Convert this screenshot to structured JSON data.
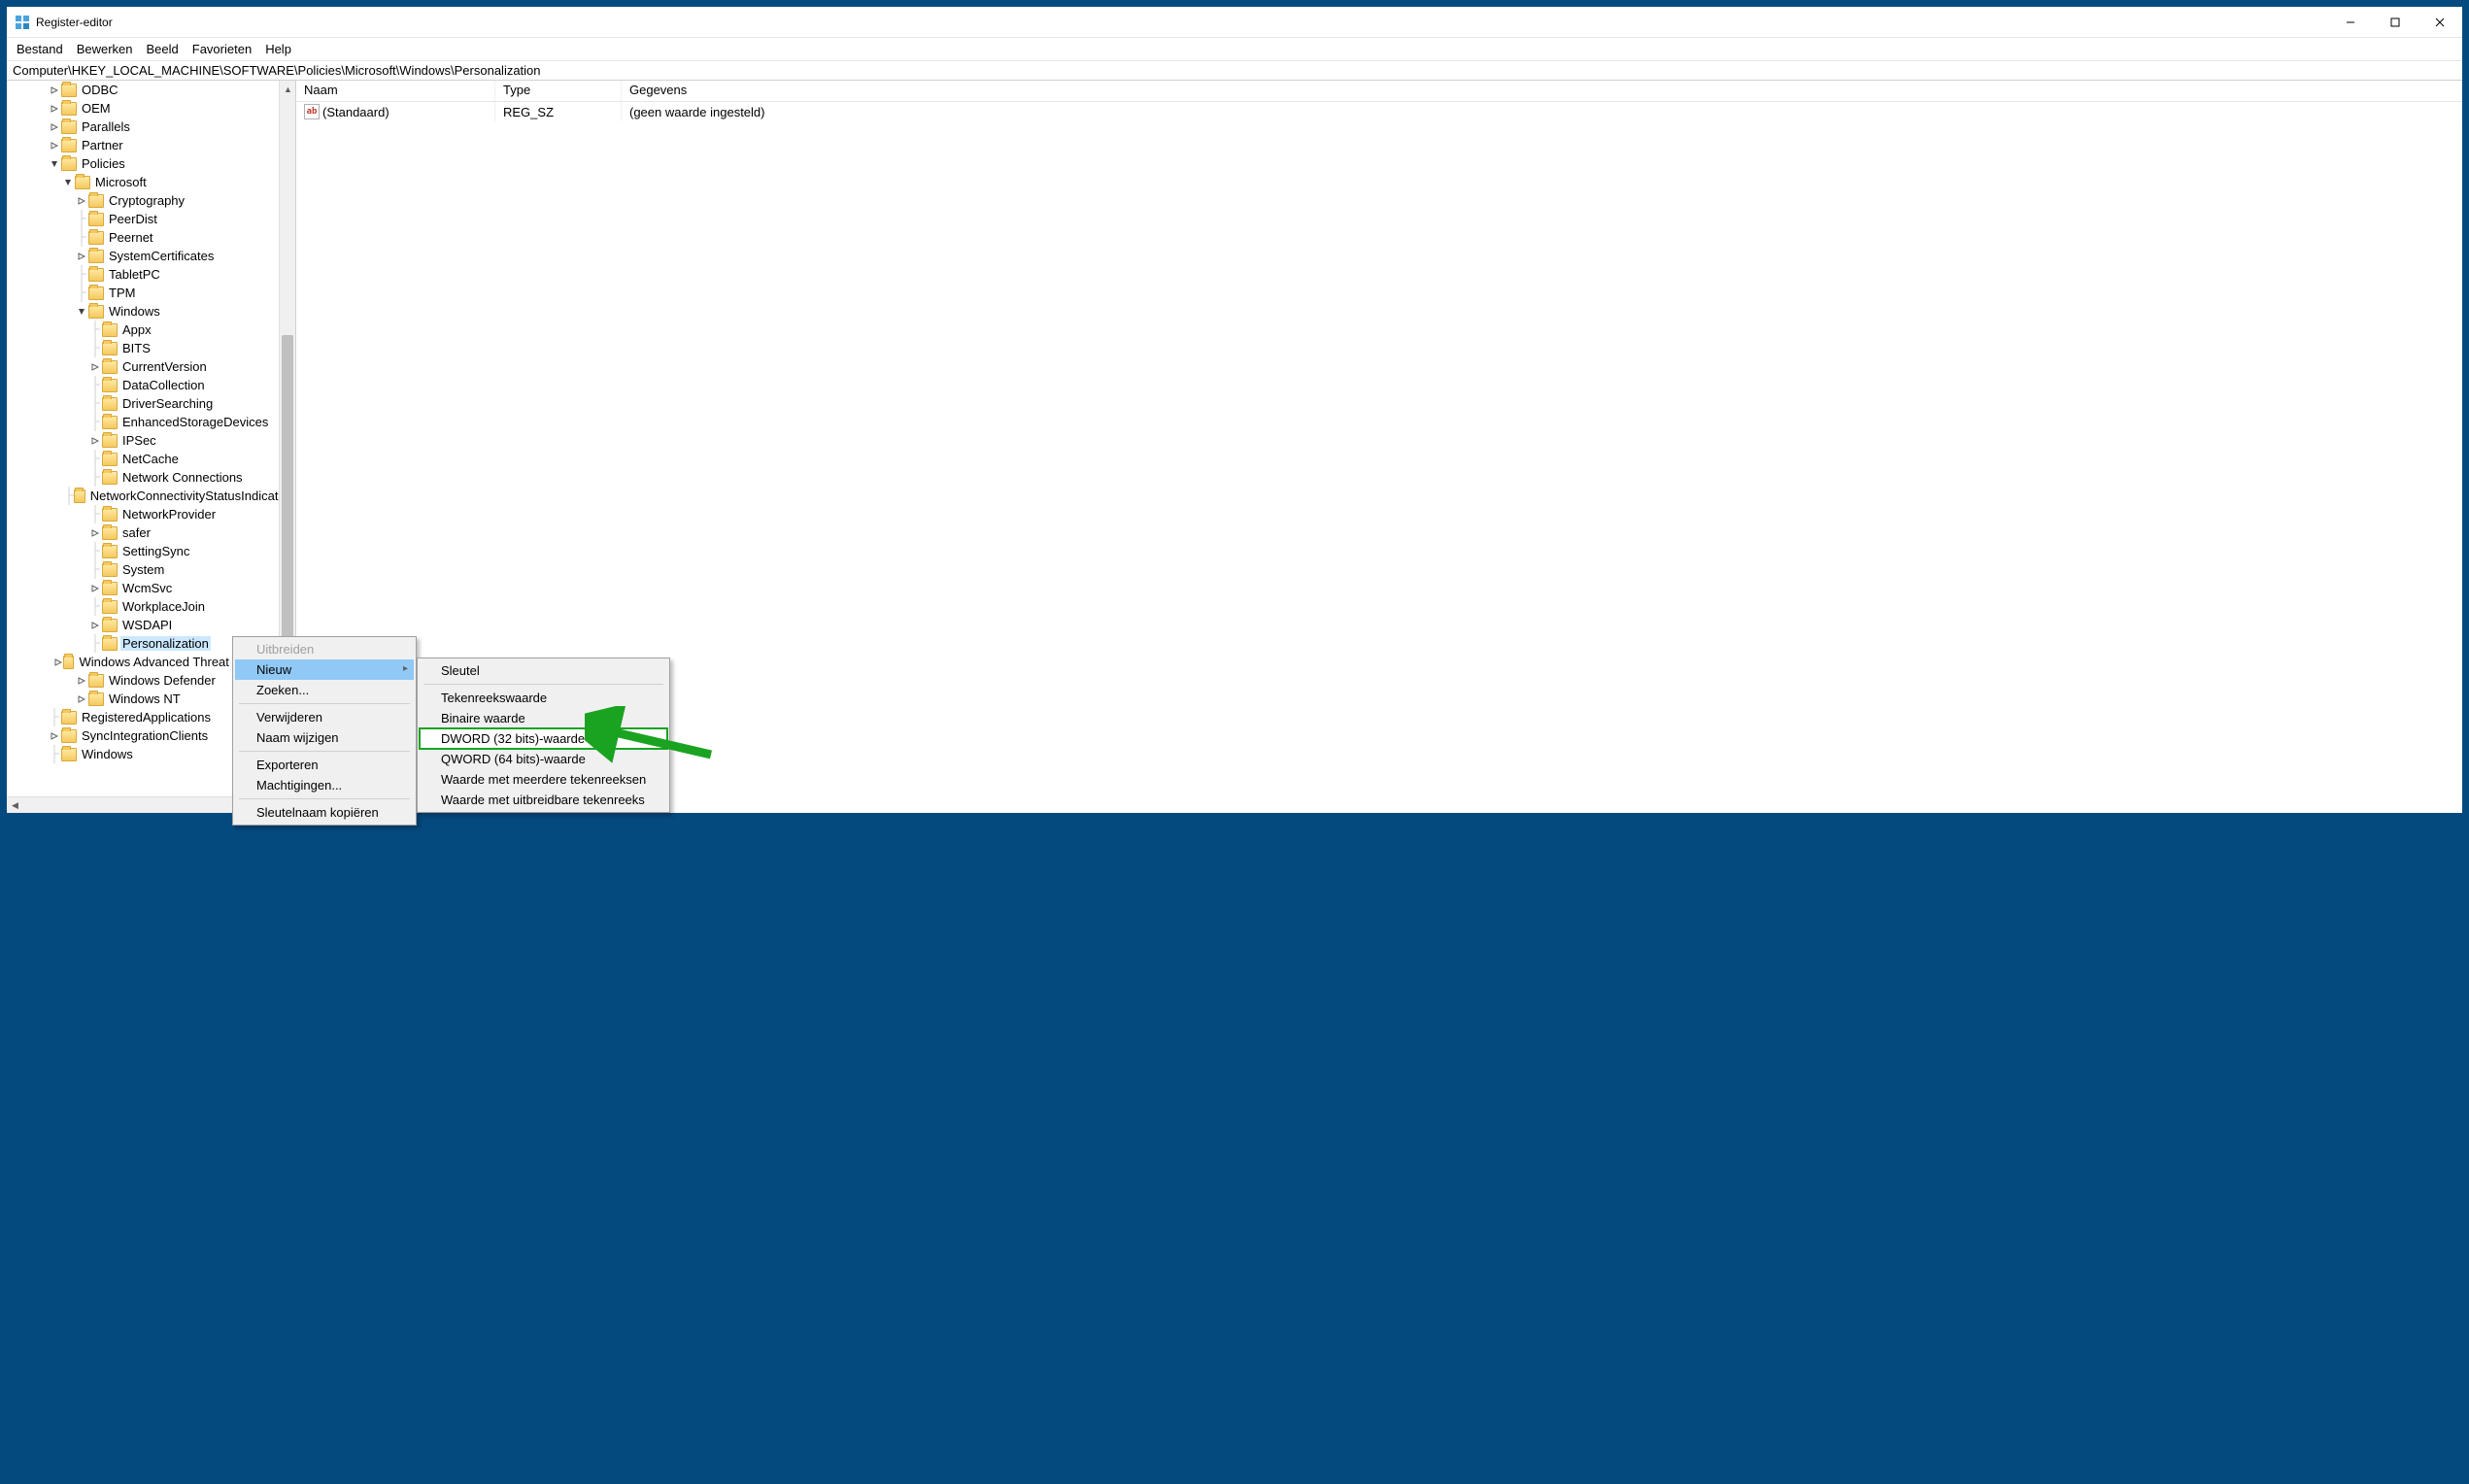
{
  "window": {
    "title": "Register-editor"
  },
  "menubar": [
    "Bestand",
    "Bewerken",
    "Beeld",
    "Favorieten",
    "Help"
  ],
  "address": "Computer\\HKEY_LOCAL_MACHINE\\SOFTWARE\\Policies\\Microsoft\\Windows\\Personalization",
  "columns": {
    "name": "Naam",
    "type": "Type",
    "data": "Gegevens"
  },
  "values": [
    {
      "name": "(Standaard)",
      "type": "REG_SZ",
      "data": "(geen waarde ingesteld)"
    }
  ],
  "tree": [
    {
      "indent": 3,
      "expand": ">",
      "label": "ODBC"
    },
    {
      "indent": 3,
      "expand": ">",
      "label": "OEM"
    },
    {
      "indent": 3,
      "expand": ">",
      "label": "Parallels"
    },
    {
      "indent": 3,
      "expand": ">",
      "label": "Partner"
    },
    {
      "indent": 3,
      "expand": "v",
      "label": "Policies"
    },
    {
      "indent": 4,
      "expand": "v",
      "label": "Microsoft"
    },
    {
      "indent": 5,
      "expand": ">",
      "label": "Cryptography"
    },
    {
      "indent": 5,
      "expand": "",
      "label": "PeerDist"
    },
    {
      "indent": 5,
      "expand": "",
      "label": "Peernet"
    },
    {
      "indent": 5,
      "expand": ">",
      "label": "SystemCertificates"
    },
    {
      "indent": 5,
      "expand": "",
      "label": "TabletPC"
    },
    {
      "indent": 5,
      "expand": "",
      "label": "TPM"
    },
    {
      "indent": 5,
      "expand": "v",
      "label": "Windows"
    },
    {
      "indent": 6,
      "expand": "",
      "label": "Appx"
    },
    {
      "indent": 6,
      "expand": "",
      "label": "BITS"
    },
    {
      "indent": 6,
      "expand": ">",
      "label": "CurrentVersion"
    },
    {
      "indent": 6,
      "expand": "",
      "label": "DataCollection"
    },
    {
      "indent": 6,
      "expand": "",
      "label": "DriverSearching"
    },
    {
      "indent": 6,
      "expand": "",
      "label": "EnhancedStorageDevices"
    },
    {
      "indent": 6,
      "expand": ">",
      "label": "IPSec"
    },
    {
      "indent": 6,
      "expand": "",
      "label": "NetCache"
    },
    {
      "indent": 6,
      "expand": "",
      "label": "Network Connections"
    },
    {
      "indent": 6,
      "expand": "",
      "label": "NetworkConnectivityStatusIndicator"
    },
    {
      "indent": 6,
      "expand": "",
      "label": "NetworkProvider"
    },
    {
      "indent": 6,
      "expand": ">",
      "label": "safer"
    },
    {
      "indent": 6,
      "expand": "",
      "label": "SettingSync"
    },
    {
      "indent": 6,
      "expand": "",
      "label": "System"
    },
    {
      "indent": 6,
      "expand": ">",
      "label": "WcmSvc"
    },
    {
      "indent": 6,
      "expand": "",
      "label": "WorkplaceJoin"
    },
    {
      "indent": 6,
      "expand": ">",
      "label": "WSDAPI"
    },
    {
      "indent": 6,
      "expand": "",
      "label": "Personalization",
      "selected": true
    },
    {
      "indent": 5,
      "expand": ">",
      "label": "Windows Advanced Threat Protection"
    },
    {
      "indent": 5,
      "expand": ">",
      "label": "Windows Defender"
    },
    {
      "indent": 5,
      "expand": ">",
      "label": "Windows NT"
    },
    {
      "indent": 3,
      "expand": "",
      "label": "RegisteredApplications"
    },
    {
      "indent": 3,
      "expand": ">",
      "label": "SyncIntegrationClients"
    },
    {
      "indent": 3,
      "expand": "",
      "label": "Windows"
    }
  ],
  "context_menu": {
    "items": [
      {
        "label": "Uitbreiden",
        "disabled": true
      },
      {
        "label": "Nieuw",
        "submenu": true,
        "hover": true
      },
      {
        "label": "Zoeken..."
      },
      {
        "sep": true
      },
      {
        "label": "Verwijderen"
      },
      {
        "label": "Naam wijzigen"
      },
      {
        "sep": true
      },
      {
        "label": "Exporteren"
      },
      {
        "label": "Machtigingen..."
      },
      {
        "sep": true
      },
      {
        "label": "Sleutelnaam kopiëren"
      }
    ]
  },
  "submenu": {
    "items": [
      {
        "label": "Sleutel"
      },
      {
        "sep": true
      },
      {
        "label": "Tekenreekswaarde"
      },
      {
        "label": "Binaire waarde"
      },
      {
        "label": "DWORD (32 bits)-waarde",
        "highlight": true
      },
      {
        "label": "QWORD (64 bits)-waarde"
      },
      {
        "label": "Waarde met meerdere tekenreeksen"
      },
      {
        "label": "Waarde met uitbreidbare tekenreeks"
      }
    ]
  }
}
